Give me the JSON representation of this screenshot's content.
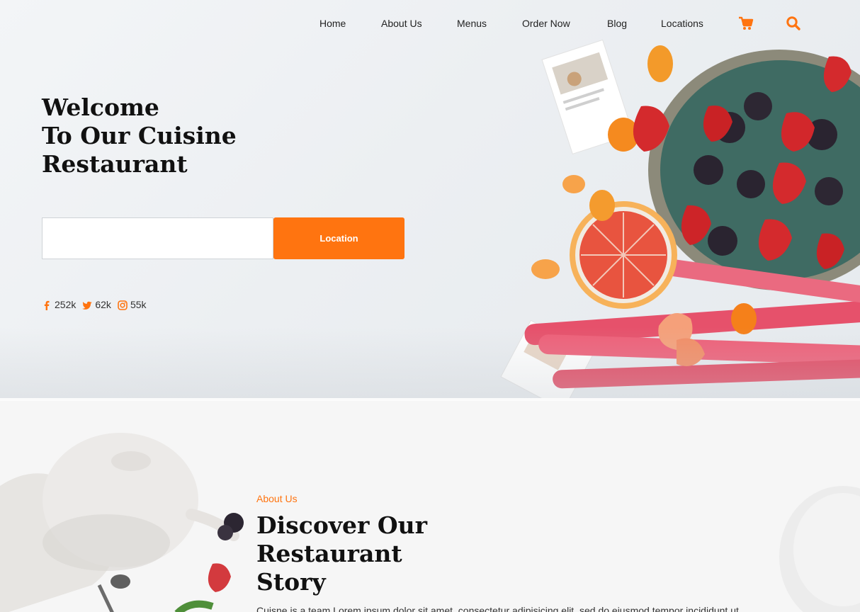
{
  "nav": {
    "items": [
      {
        "label": "Home"
      },
      {
        "label": "About Us"
      },
      {
        "label": "Menus"
      },
      {
        "label": "Order Now"
      },
      {
        "label": "Blog"
      },
      {
        "label": "Locations"
      }
    ],
    "icons": [
      "cart-icon",
      "search-icon"
    ]
  },
  "hero": {
    "title_lines": [
      "Welcome",
      "To Our Cuisine",
      "Restaurant"
    ],
    "location_input": {
      "value": "",
      "placeholder": ""
    },
    "location_button": "Location",
    "social": [
      {
        "icon": "facebook-icon",
        "count": "252k"
      },
      {
        "icon": "twitter-icon",
        "count": "62k"
      },
      {
        "icon": "instagram-icon",
        "count": "55k"
      }
    ]
  },
  "about": {
    "kicker": "About Us",
    "title_lines": [
      "Discover Our",
      "Restaurant",
      "Story"
    ],
    "text": "Cuisne is a team Lorem ipsum dolor sit amet, consectetur adipisicing elit, sed do eiusmod tempor incididunt ut"
  },
  "colors": {
    "accent": "#ff7410",
    "heading": "#111111",
    "background": "#f6f6f6"
  }
}
